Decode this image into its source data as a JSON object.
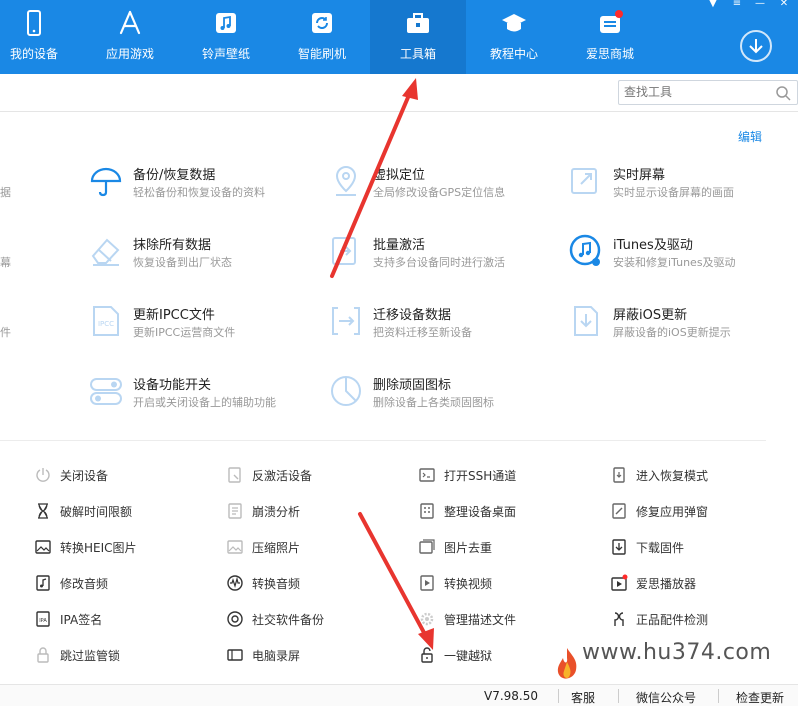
{
  "nav": {
    "items": [
      {
        "label": "我的设备",
        "icon": "phone-icon"
      },
      {
        "label": "应用游戏",
        "icon": "app-store-icon"
      },
      {
        "label": "铃声壁纸",
        "icon": "music-icon"
      },
      {
        "label": "智能刷机",
        "icon": "flash-icon"
      },
      {
        "label": "工具箱",
        "icon": "toolbox-icon"
      },
      {
        "label": "教程中心",
        "icon": "graduation-cap-icon"
      },
      {
        "label": "爱思商城",
        "icon": "shop-icon"
      }
    ],
    "active_index": 4
  },
  "search": {
    "placeholder": "查找工具"
  },
  "edit_label": "编辑",
  "partial_left": [
    "据",
    "幕",
    "件"
  ],
  "big_tools": [
    {
      "title": "备份/恢复数据",
      "desc": "轻松备份和恢复设备的资料",
      "icon": "umbrella-icon"
    },
    {
      "title": "虚拟定位",
      "desc": "全局修改设备GPS定位信息",
      "icon": "location-pin-icon"
    },
    {
      "title": "实时屏幕",
      "desc": "实时显示设备屏幕的画面",
      "icon": "screen-mirror-icon"
    },
    {
      "title": "抹除所有数据",
      "desc": "恢复设备到出厂状态",
      "icon": "eraser-icon"
    },
    {
      "title": "批量激活",
      "desc": "支持多台设备同时进行激活",
      "icon": "batch-activate-icon"
    },
    {
      "title": "iTunes及驱动",
      "desc": "安装和修复iTunes及驱动",
      "icon": "itunes-icon"
    },
    {
      "title": "更新IPCC文件",
      "desc": "更新IPCC运营商文件",
      "icon": "ipcc-file-icon"
    },
    {
      "title": "迁移设备数据",
      "desc": "把资料迁移至新设备",
      "icon": "migrate-icon"
    },
    {
      "title": "屏蔽iOS更新",
      "desc": "屏蔽设备的iOS更新提示",
      "icon": "block-update-icon"
    },
    {
      "title": "设备功能开关",
      "desc": "开启或关闭设备上的辅助功能",
      "icon": "toggle-icon"
    },
    {
      "title": "删除顽固图标",
      "desc": "删除设备上各类顽固图标",
      "icon": "pie-icon"
    }
  ],
  "small_tools": [
    {
      "label": "关闭设备",
      "icon": "power-icon"
    },
    {
      "label": "反激活设备",
      "icon": "deactivate-icon"
    },
    {
      "label": "打开SSH通道",
      "icon": "terminal-icon"
    },
    {
      "label": "进入恢复模式",
      "icon": "recovery-icon"
    },
    {
      "label": "破解时间限额",
      "icon": "hourglass-icon"
    },
    {
      "label": "崩溃分析",
      "icon": "crash-report-icon"
    },
    {
      "label": "整理设备桌面",
      "icon": "grid-icon"
    },
    {
      "label": "修复应用弹窗",
      "icon": "repair-popup-icon"
    },
    {
      "label": "转换HEIC图片",
      "icon": "heic-image-icon"
    },
    {
      "label": "压缩照片",
      "icon": "photo-icon"
    },
    {
      "label": "图片去重",
      "icon": "dedupe-image-icon"
    },
    {
      "label": "下载固件",
      "icon": "download-firmware-icon"
    },
    {
      "label": "修改音频",
      "icon": "audio-edit-icon"
    },
    {
      "label": "转换音频",
      "icon": "waveform-icon"
    },
    {
      "label": "转换视频",
      "icon": "video-icon"
    },
    {
      "label": "爱思播放器",
      "icon": "player-icon"
    },
    {
      "label": "IPA签名",
      "icon": "ipa-icon"
    },
    {
      "label": "社交软件备份",
      "icon": "social-backup-icon"
    },
    {
      "label": "管理描述文件",
      "icon": "gear-icon"
    },
    {
      "label": "正品配件检测",
      "icon": "earphone-icon"
    },
    {
      "label": "跳过监管锁",
      "icon": "lock-icon"
    },
    {
      "label": "电脑录屏",
      "icon": "screen-record-icon"
    },
    {
      "label": "一键越狱",
      "icon": "unlock-icon"
    }
  ],
  "status": {
    "version": "V7.98.50",
    "service": "客服",
    "wechat": "微信公众号",
    "update": "检查更新"
  },
  "watermark": "www.hu374.com",
  "colors": {
    "nav_bg": "#1a88e5",
    "nav_active": "#1578cf",
    "icon_blue": "#1a88e5",
    "arrow_red": "#e8352f"
  }
}
